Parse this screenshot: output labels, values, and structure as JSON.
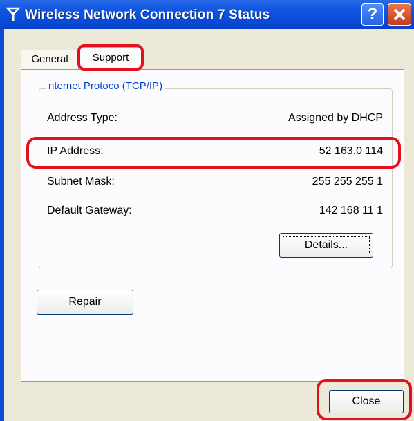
{
  "window": {
    "title": "Wireless Network Connection 7 Status",
    "help_button": "?",
    "close_button": "X"
  },
  "tabs": [
    {
      "label": "General"
    },
    {
      "label": "Support"
    }
  ],
  "group": {
    "title": "nternet Protoco (TCP/IP)"
  },
  "rows": [
    {
      "label": "Address Type:",
      "value": "Assigned by DHCP"
    },
    {
      "label": "IP Address:",
      "value": "52 163.0 114"
    },
    {
      "label": "Subnet Mask:",
      "value": "255 255 255 1"
    },
    {
      "label": "Default Gateway:",
      "value": "142 168 11 1"
    }
  ],
  "buttons": {
    "details": "Details...",
    "repair": "Repair",
    "close": "Close"
  },
  "colors": {
    "titlebar": "#0a4bd8",
    "highlight": "#e3111b",
    "group_title": "#0046d5"
  },
  "icons": {
    "title_icon": "wireless-antenna-icon"
  }
}
